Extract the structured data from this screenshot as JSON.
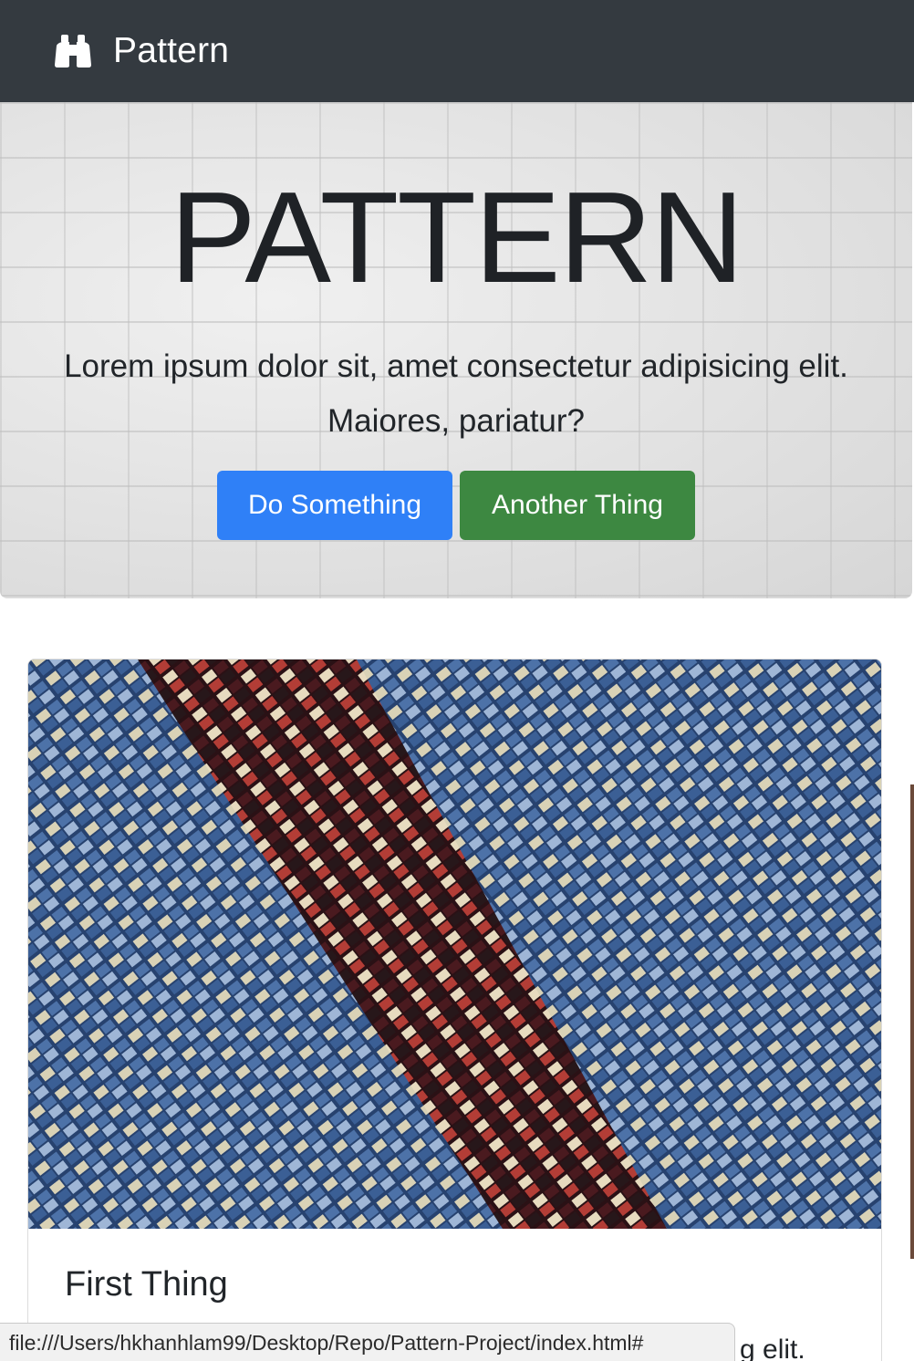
{
  "navbar": {
    "brand_label": "Pattern",
    "brand_icon": "binoculars-icon",
    "background": "#343a40"
  },
  "hero": {
    "title": "PATTERN",
    "lead": "Lorem ipsum dolor sit, amet consectetur adipisicing elit. Maiores, pariatur?",
    "primary_button": "Do Something",
    "secondary_button": "Another Thing",
    "primary_color": "#2f80f7",
    "secondary_color": "#3d8841"
  },
  "card": {
    "title": "First Thing",
    "text_visible": "g elit.",
    "image_description_icon": "building-facade-image"
  },
  "status_bar": {
    "url": "file:///Users/hkhanhlam99/Desktop/Repo/Pattern-Project/index.html#"
  }
}
